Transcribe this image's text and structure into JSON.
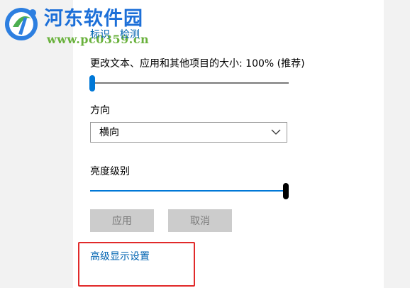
{
  "watermark": {
    "title": "河东软件园",
    "url": "www.pc0359.cn"
  },
  "links": {
    "identify": "标识",
    "detect": "检测"
  },
  "scale": {
    "label": "更改文本、应用和其他项目的大小: 100% (推荐)",
    "value_fraction": 0.0
  },
  "orientation": {
    "label": "方向",
    "selected": "横向"
  },
  "brightness": {
    "label": "亮度级别",
    "value_fraction": 1.0
  },
  "buttons": {
    "apply": "应用",
    "cancel": "取消"
  },
  "advanced": {
    "label": "高级显示设置"
  },
  "colors": {
    "accent": "#0078d7",
    "link": "#0063b1",
    "highlight_box": "#e12a2a",
    "watermark_title": "#1c6fd8",
    "watermark_url": "#69b13c"
  }
}
